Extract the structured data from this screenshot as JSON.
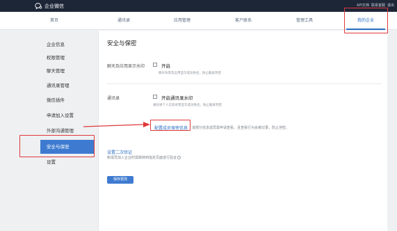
{
  "topbar": {
    "logo_text": "企业微信",
    "links": [
      "API文档",
      "联系客服",
      "退出"
    ]
  },
  "nav": {
    "items": [
      {
        "label": "首页",
        "active": false
      },
      {
        "label": "通讯录",
        "active": false
      },
      {
        "label": "应用管理",
        "active": false
      },
      {
        "label": "客户联系",
        "active": false
      },
      {
        "label": "管理工具",
        "active": false
      },
      {
        "label": "我的企业",
        "active": true
      }
    ]
  },
  "sidebar": {
    "items": [
      {
        "label": "企业信息",
        "active": false
      },
      {
        "label": "权限管理",
        "active": false
      },
      {
        "label": "聊天管理",
        "active": false
      },
      {
        "label": "通讯录管理",
        "active": false
      },
      {
        "label": "微信插件",
        "active": false
      },
      {
        "label": "申请加入设置",
        "active": false
      },
      {
        "label": "外部沟通管理",
        "active": false
      },
      {
        "label": "安全与保密",
        "active": true
      },
      {
        "label": "设置",
        "active": false
      }
    ]
  },
  "main": {
    "title": "安全与保密",
    "chat_watermark": {
      "label": "聊天及应用显示水印",
      "option": "开启",
      "hint": "聊天背景及应用显示成员姓名，防止截屏泄密"
    },
    "contacts_watermark": {
      "label": "通讯录",
      "option": "开启通讯录水印",
      "hint": "通讯录个人信息背景显示成员姓名，防止截屏泄密"
    },
    "confidential_info": {
      "link": "配置成员保密信息",
      "desc": "该部分信息成员需申请查看，且查看行为会被记录，防止泄密。"
    },
    "two_factor": {
      "link": "设置二次验证",
      "desc": "新成员加入企业时需跳转到指定页面进行验证"
    },
    "save_label": "保存更改"
  },
  "colors": {
    "topbar": "#1d2637",
    "accent": "#3e7bd0",
    "link": "#2b6fc2",
    "highlight": "#e0383b"
  }
}
